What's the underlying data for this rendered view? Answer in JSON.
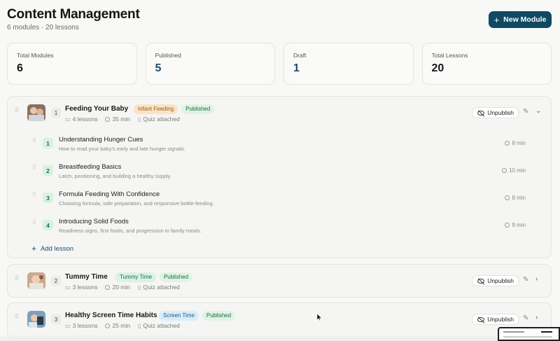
{
  "header": {
    "title": "Content Management",
    "subtitle": "6 modules · 20 lessons",
    "new_module_label": "New Module"
  },
  "stats": [
    {
      "label": "Total Modules",
      "value": "6"
    },
    {
      "label": "Published",
      "value": "5"
    },
    {
      "label": "Draft",
      "value": "1"
    },
    {
      "label": "Total Lessons",
      "value": "20"
    }
  ],
  "modules": [
    {
      "order": "1",
      "title": "Feeding Your Baby",
      "category": "Infant Feeding",
      "status": "Published",
      "lessons_count": "4 lessons",
      "duration": "35 min",
      "quiz": "Quiz attached",
      "action": "Unpublish",
      "expanded": true,
      "lessons": [
        {
          "num": "1",
          "title": "Understanding Hunger Cues",
          "desc": "How to read your baby's early and late hunger signals.",
          "duration": "8 min"
        },
        {
          "num": "2",
          "title": "Breastfeeding Basics",
          "desc": "Latch, positioning, and building a healthy supply.",
          "duration": "10 min"
        },
        {
          "num": "3",
          "title": "Formula Feeding With Confidence",
          "desc": "Choosing formula, safe preparation, and responsive bottle-feeding.",
          "duration": "8 min"
        },
        {
          "num": "4",
          "title": "Introducing Solid Foods",
          "desc": "Readiness signs, first foods, and progression to family meals.",
          "duration": "9 min"
        }
      ],
      "add_lesson_label": "Add lesson"
    },
    {
      "order": "2",
      "title": "Tummy Time",
      "category": "Tummy Time",
      "status": "Published",
      "lessons_count": "3 lessons",
      "duration": "20 min",
      "quiz": "Quiz attached",
      "action": "Unpublish",
      "expanded": false
    },
    {
      "order": "3",
      "title": "Healthy Screen Time Habits",
      "category": "Screen Time",
      "status": "Published",
      "lessons_count": "3 lessons",
      "duration": "25 min",
      "quiz": "Quiz attached",
      "action": "Unpublish",
      "expanded": false
    }
  ],
  "icons": {
    "plus": "plus-icon",
    "drag": "drag-handle-icon",
    "lessons": "book-icon",
    "duration": "clock-icon",
    "quiz": "clipboard-icon",
    "unpublish": "eye-off-icon",
    "edit": "pencil-icon",
    "expand": "chevron-down-icon",
    "collapse": "chevron-right-icon"
  },
  "colors": {
    "primary": "#0f4a63",
    "accent_text": "#1d4c6b",
    "published_bg": "#dff3e6",
    "feeding_bg": "#fbe3c5",
    "screen_bg": "#d8edf8"
  }
}
